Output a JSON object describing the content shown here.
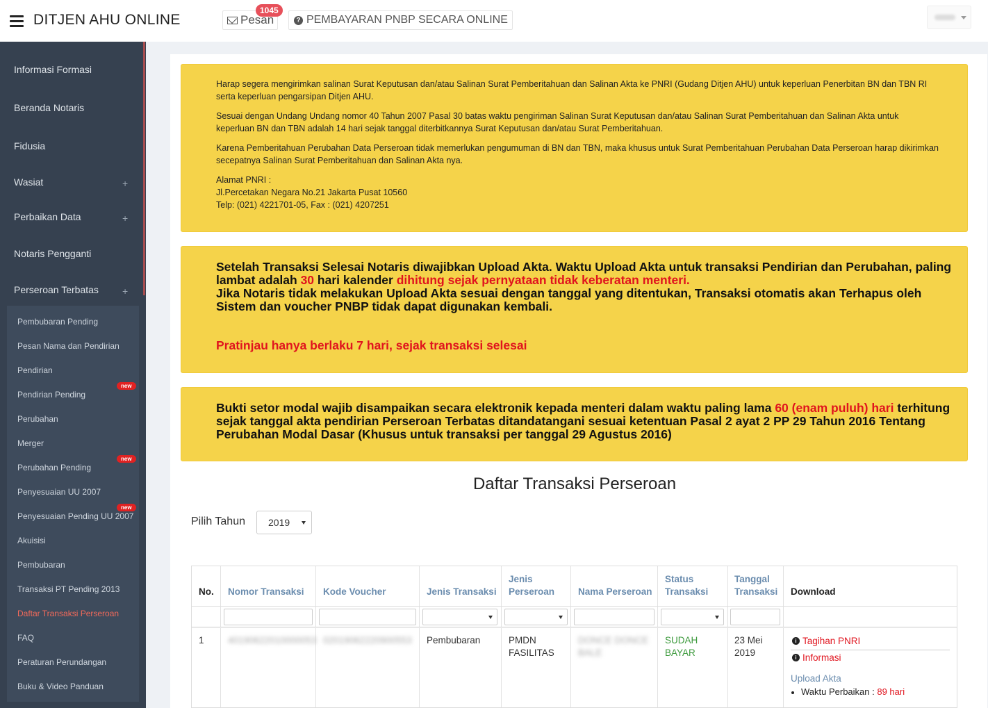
{
  "header": {
    "brand": "DITJEN AHU ONLINE",
    "pesan_label": "Pesan",
    "pesan_count": "1045",
    "pnbp_label": "PEMBAYARAN PNBP SECARA ONLINE"
  },
  "sidebar": {
    "top_items": [
      {
        "label": "Informasi Formasi",
        "expandable": false
      },
      {
        "label": "Beranda Notaris",
        "expandable": false
      },
      {
        "label": "Fidusia",
        "expandable": false
      },
      {
        "label": "Wasiat",
        "expandable": true
      },
      {
        "label": "Perbaikan Data",
        "expandable": true
      },
      {
        "label": "Notaris Pengganti",
        "expandable": false
      },
      {
        "label": "Perseroan Terbatas",
        "expandable": true
      }
    ],
    "plus_symbol": "+",
    "new_badge": "new",
    "sub_items": [
      {
        "label": "Pembubaran Pending",
        "badge": false,
        "active": false
      },
      {
        "label": "Pesan Nama dan Pendirian",
        "badge": false,
        "active": false
      },
      {
        "label": "Pendirian",
        "badge": false,
        "active": false
      },
      {
        "label": "Pendirian Pending",
        "badge": true,
        "active": false
      },
      {
        "label": "Perubahan",
        "badge": false,
        "active": false
      },
      {
        "label": "Merger",
        "badge": false,
        "active": false
      },
      {
        "label": "Perubahan Pending",
        "badge": true,
        "active": false
      },
      {
        "label": "Penyesuaian UU 2007",
        "badge": false,
        "active": false
      },
      {
        "label": "Penyesuaian Pending UU 2007",
        "badge": true,
        "active": false
      },
      {
        "label": "Akuisisi",
        "badge": false,
        "active": false
      },
      {
        "label": "Pembubaran",
        "badge": false,
        "active": false
      },
      {
        "label": "Transaksi PT Pending 2013",
        "badge": false,
        "active": false
      },
      {
        "label": "Daftar Transaksi Perseroan",
        "badge": false,
        "active": true
      },
      {
        "label": "FAQ",
        "badge": false,
        "active": false
      },
      {
        "label": "Peraturan Perundangan",
        "badge": false,
        "active": false
      },
      {
        "label": "Buku & Video Panduan",
        "badge": false,
        "active": false
      }
    ]
  },
  "notice1": {
    "p1": "Harap segera mengirimkan salinan Surat Keputusan dan/atau Salinan Surat Pemberitahuan dan Salinan Akta ke PNRI (Gudang Ditjen AHU) untuk keperluan Penerbitan BN dan TBN RI serta keperluan pengarsipan Ditjen AHU.",
    "p2": "Sesuai dengan Undang Undang nomor 40 Tahun 2007 Pasal 30 batas waktu pengiriman Salinan Surat Keputusan dan/atau Salinan Surat Pemberitahuan dan Salinan Akta untuk keperluan BN dan TBN adalah 14 hari sejak tanggal diterbitkannya Surat Keputusan dan/atau Surat Pemberitahuan.",
    "p3": "Karena Pemberitahuan Perubahan Data Perseroan tidak memerlukan pengumuman di BN dan TBN, maka khusus untuk Surat Pemberitahuan Perubahan Data Perseroan harap dikirimkan secepatnya Salinan Surat Pemberitahuan dan Salinan Akta nya.",
    "addr_title": "Alamat PNRI :",
    "addr_line": "Jl.Percetakan Negara No.21 Jakarta Pusat 10560",
    "addr_phone": "Telp: (021) 4221701-05, Fax : (021) 4207251"
  },
  "notice2": {
    "t1": "Setelah Transaksi Selesai Notaris diwajibkan Upload Akta. Waktu Upload Akta untuk transaksi Pendirian dan Perubahan, paling lambat adalah ",
    "t1_red": "30",
    "t2": " hari kalender ",
    "t2_red": "dihitung sejak pernyataan tidak keberatan menteri.",
    "t3": "Jika Notaris tidak melakukan Upload Akta sesuai dengan tanggal yang ditentukan, Transaksi otomatis akan Terhapus oleh Sistem dan voucher PNBP tidak dapat digunakan kembali.",
    "preview": "Pratinjau hanya berlaku 7 hari, sejak transaksi selesai"
  },
  "notice3": {
    "t1": "Bukti setor modal wajib disampaikan secara elektronik kepada menteri dalam waktu paling lama ",
    "t1_red": "60 (enam puluh) hari",
    "t2": " terhitung sejak tanggal akta pendirian Perseroan Terbatas ditandatangani sesuai ketentuan Pasal 2 ayat 2 PP 29 Tahun 2016 Tentang Perubahan Modal Dasar (Khusus untuk transaksi per tanggal 29 Agustus 2016)"
  },
  "page_title": "Daftar Transaksi Perseroan",
  "year_filter": {
    "label": "Pilih Tahun",
    "value": "2019"
  },
  "table": {
    "headers": {
      "no": "No.",
      "nomor": "Nomor Transaksi",
      "kode": "Kode Voucher",
      "jenis_transaksi": "Jenis Transaksi",
      "jenis_perseroan_1": "Jenis",
      "jenis_perseroan_2": "Perseroan",
      "nama": "Nama Perseroan",
      "status_1": "Status",
      "status_2": "Transaksi",
      "tanggal_1": "Tanggal",
      "tanggal_2": "Transaksi",
      "download": "Download"
    },
    "rows": [
      {
        "no": "1",
        "nomor": "40190622010000053",
        "kode": "02019062220900553",
        "jenis_transaksi": "Pembubaran",
        "jenis_perseroan_1": "PMDN",
        "jenis_perseroan_2": "FASILITAS",
        "nama_1": "DONCE DONCE",
        "nama_2": "BALE",
        "status_1": "SUDAH",
        "status_2": "BAYAR",
        "tanggal_1": "23 Mei",
        "tanggal_2": "2019",
        "link_tagihan": "Tagihan PNRI",
        "link_informasi": "Informasi",
        "upload_label": "Upload Akta",
        "waktu_label": "Waktu Perbaikan",
        "waktu_sep": " : ",
        "waktu_value": "89 hari"
      }
    ]
  },
  "colors": {
    "sidebar_bg": "#364150",
    "notice_bg": "#f5d34a",
    "alert_red": "#e0141e",
    "header_link": "#6a8cae",
    "status_green": "#3c9a3c"
  }
}
